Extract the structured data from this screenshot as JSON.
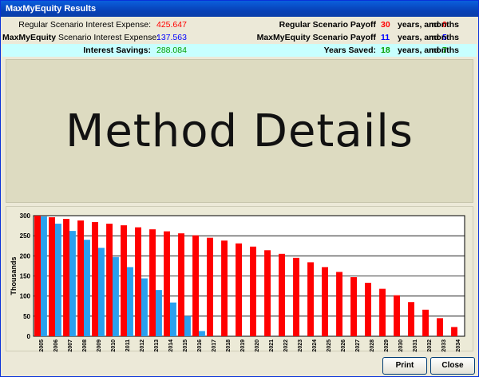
{
  "window": {
    "title": "MaxMyEquity Results"
  },
  "stats": {
    "regular_interest_label": "Regular Scenario Interest Expense:",
    "regular_interest_value": "425.647",
    "mme_interest_label_bold": "MaxMyEquity",
    "mme_interest_label_rest": " Scenario Interest Expense:",
    "mme_interest_value": "137.563",
    "savings_label": "Interest Savings:",
    "savings_value": "288.084",
    "regular_payoff_label": "Regular Scenario Payoff",
    "regular_payoff_years": "30",
    "regular_payoff_months": "0",
    "mme_payoff_label": "MaxMyEquity Scenario Payoff",
    "mme_payoff_years": "11",
    "mme_payoff_months": "5",
    "years_saved_label": "Years Saved:",
    "years_saved_years": "18",
    "years_saved_months": "7",
    "years_word": "years, and",
    "months_word": "months"
  },
  "banner": {
    "text": "Method Details"
  },
  "chart_data": {
    "type": "bar",
    "ylabel": "Thousands",
    "ylim": [
      0,
      300
    ],
    "yticks": [
      0,
      50,
      100,
      150,
      200,
      250,
      300
    ],
    "categories": [
      "2005",
      "2006",
      "2007",
      "2008",
      "2009",
      "2010",
      "2011",
      "2012",
      "2013",
      "2014",
      "2015",
      "2016",
      "2017",
      "2018",
      "2019",
      "2020",
      "2021",
      "2022",
      "2023",
      "2024",
      "2025",
      "2026",
      "2027",
      "2028",
      "2029",
      "2030",
      "2031",
      "2032",
      "2033",
      "2034"
    ],
    "series": [
      {
        "color": "#ff0000",
        "values": [
          300,
          296,
          292,
          288,
          284,
          280,
          276,
          271,
          266,
          261,
          256,
          251,
          245,
          238,
          231,
          223,
          214,
          205,
          195,
          184,
          172,
          160,
          147,
          133,
          118,
          102,
          85,
          66,
          45,
          23
        ]
      },
      {
        "color": "#2aa0ee",
        "values": [
          298,
          280,
          262,
          240,
          220,
          197,
          172,
          144,
          115,
          84,
          50,
          13,
          0,
          0,
          0,
          0,
          0,
          0,
          0,
          0,
          0,
          0,
          0,
          0,
          0,
          0,
          0,
          0,
          0,
          0
        ]
      }
    ]
  },
  "buttons": {
    "print": "Print",
    "close": "Close"
  }
}
